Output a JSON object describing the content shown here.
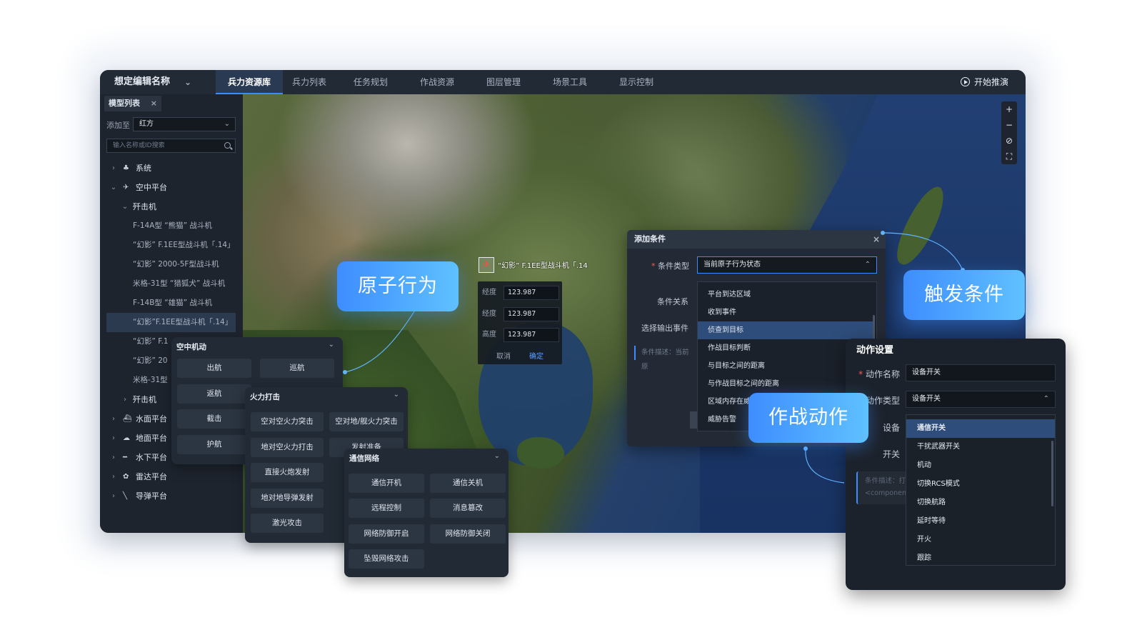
{
  "app": {
    "title": "想定编辑名称",
    "start_label": "开始推演",
    "tabs": [
      "兵力资源库",
      "兵力列表",
      "任务规划",
      "作战资源",
      "图层管理",
      "场景工具",
      "显示控制"
    ],
    "active_tab": "兵力资源库"
  },
  "sidebar": {
    "tab_label": "模型列表",
    "close_glyph": "×",
    "add_label": "添加至",
    "add_value": "红方",
    "search_placeholder": "输入名称或ID搜索",
    "items": [
      {
        "label": "系统",
        "icon": "group-icon",
        "glyph": "♣",
        "level": 0,
        "caret": "›"
      },
      {
        "label": "空中平台",
        "icon": "aircraft-icon",
        "glyph": "✈",
        "level": 0,
        "caret": "⌄"
      },
      {
        "label": "歼击机",
        "icon": "",
        "glyph": "",
        "level": 1,
        "caret": "⌄"
      },
      {
        "label": "F-14A型 “熊猫” 战斗机",
        "level": 2
      },
      {
        "label": "“幻影” F.1EE型战斗机「.14」",
        "level": 2
      },
      {
        "label": "“幻影” 2000-5F型战斗机",
        "level": 2
      },
      {
        "label": "米格-31型 “猎狐犬” 战斗机",
        "level": 2
      },
      {
        "label": "F-14B型 “雄猫” 战斗机",
        "level": 2
      },
      {
        "label": "“幻影”F.1EE型战斗机「.14」",
        "level": 2,
        "selected": true
      },
      {
        "label": "“幻影” F.1",
        "level": 2
      },
      {
        "label": "“幻影” 20",
        "level": 2
      },
      {
        "label": "米格-31型",
        "level": 2
      },
      {
        "label": "歼击机",
        "icon": "",
        "glyph": "",
        "level": 1,
        "caret": "›"
      },
      {
        "label": "水面平台",
        "icon": "ship-icon",
        "glyph": "⛴",
        "level": 0,
        "caret": "›"
      },
      {
        "label": "地面平台",
        "icon": "ground-vehicle-icon",
        "glyph": "☁",
        "level": 0,
        "caret": "›"
      },
      {
        "label": "水下平台",
        "icon": "submarine-icon",
        "glyph": "━",
        "level": 0,
        "caret": "›"
      },
      {
        "label": "雷达平台",
        "icon": "radar-icon",
        "glyph": "✿",
        "level": 0,
        "caret": "›"
      },
      {
        "label": "导弹平台",
        "icon": "missile-icon",
        "glyph": "╲",
        "level": 0,
        "caret": "›"
      }
    ]
  },
  "map": {
    "zoom_controls": [
      "+",
      "−",
      "⊘",
      "⛶"
    ],
    "marker_label": "“幻影” F.1EE型战斗机「.14",
    "coords": [
      {
        "key": "经度",
        "value": "123.987"
      },
      {
        "key": "经度",
        "value": "123.987"
      },
      {
        "key": "高度",
        "value": "123.987"
      }
    ],
    "cancel": "取消",
    "confirm": "确定"
  },
  "air_maneuver": {
    "title": "空中机动",
    "buttons": [
      "出航",
      "巡航",
      "返航",
      "截击",
      "护航"
    ]
  },
  "firepower": {
    "title": "火力打击",
    "buttons": [
      "空对空火力突击",
      "空对地/舰火力突击",
      "地对空火力打击",
      "发射准备",
      "直接火炮发射",
      "地对地导弹发射",
      "激光攻击"
    ]
  },
  "comm_network": {
    "title": "通信网络",
    "buttons": [
      "通信开机",
      "通信关机",
      "远程控制",
      "消息篡改",
      "网络防御开启",
      "网络防御关闭",
      "坠毁网络攻击"
    ]
  },
  "callouts": {
    "atomic": "原子行为",
    "trigger": "触发条件",
    "action": "作战动作"
  },
  "add_condition": {
    "title": "添加条件",
    "close": "×",
    "type_label": "条件类型",
    "type_value": "当前原子行为状态",
    "relation_label": "条件关系",
    "output_label": "选择输出事件",
    "desc_placeholder": "条件描述：当前原",
    "options": [
      "平台到达区域",
      "收到事件",
      "侦查到目标",
      "作战目标判断",
      "与目标之间的距离",
      "与作战目标之间的距离",
      "区域内存在威",
      "威胁告警"
    ],
    "selected": "侦查到目标"
  },
  "action_settings": {
    "title": "动作设置",
    "name_label": "动作名称",
    "name_value": "设备开关",
    "type_label": "动作类型",
    "type_value": "设备开关",
    "device_label": "设备",
    "switch_label": "开关",
    "desc_placeholder_1": "条件描述：打",
    "desc_placeholder_2": "<component",
    "options": [
      "通信开关",
      "干扰武器开关",
      "机动",
      "切换RCS模式",
      "切换航路",
      "延时等待",
      "开火",
      "跟踪"
    ],
    "selected": "通信开关"
  },
  "colors": {
    "accent": "#3d8bff",
    "callout_start": "#3e8dff",
    "callout_end": "#5fc1ff",
    "panel_bg": "#222a35",
    "selected_bg": "#2f4d7a"
  }
}
